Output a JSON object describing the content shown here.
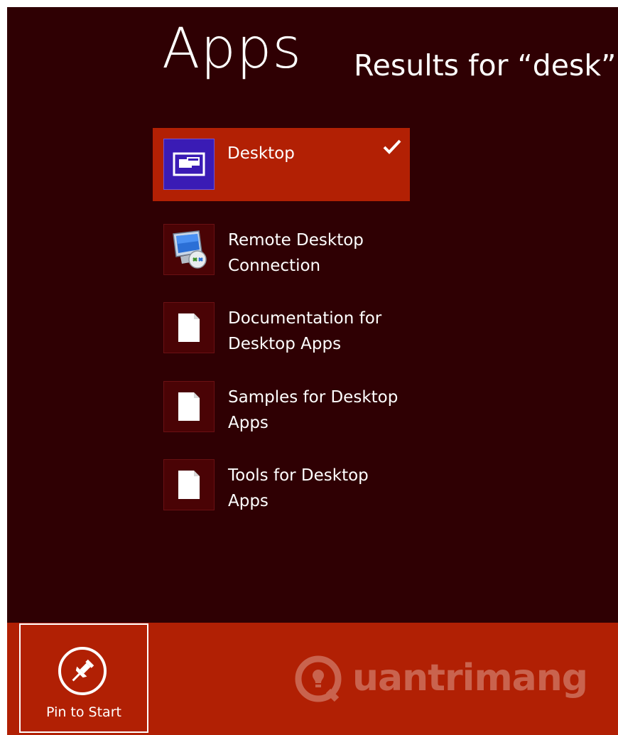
{
  "header": {
    "title": "Apps",
    "results_label": "Results for “desk”"
  },
  "results": [
    {
      "label": "Desktop",
      "icon": "desktop-icon",
      "selected": true
    },
    {
      "label": "Remote Desktop Connection",
      "icon": "remote-desktop-icon",
      "selected": false
    },
    {
      "label": "Documentation for Desktop Apps",
      "icon": "document-icon",
      "selected": false
    },
    {
      "label": "Samples for Desktop Apps",
      "icon": "document-icon",
      "selected": false
    },
    {
      "label": "Tools for Desktop Apps",
      "icon": "document-icon",
      "selected": false
    }
  ],
  "app_bar": {
    "pin_label": "Pin to Start",
    "pin_icon": "pin-icon"
  },
  "watermark": {
    "text": "uantrimang",
    "logo_icon": "lightbulb-q-logo-icon"
  },
  "colors": {
    "background": "#2f0003",
    "accent": "#b22004",
    "desktop_tile": "#3a1bb5",
    "text": "#ffffff"
  }
}
